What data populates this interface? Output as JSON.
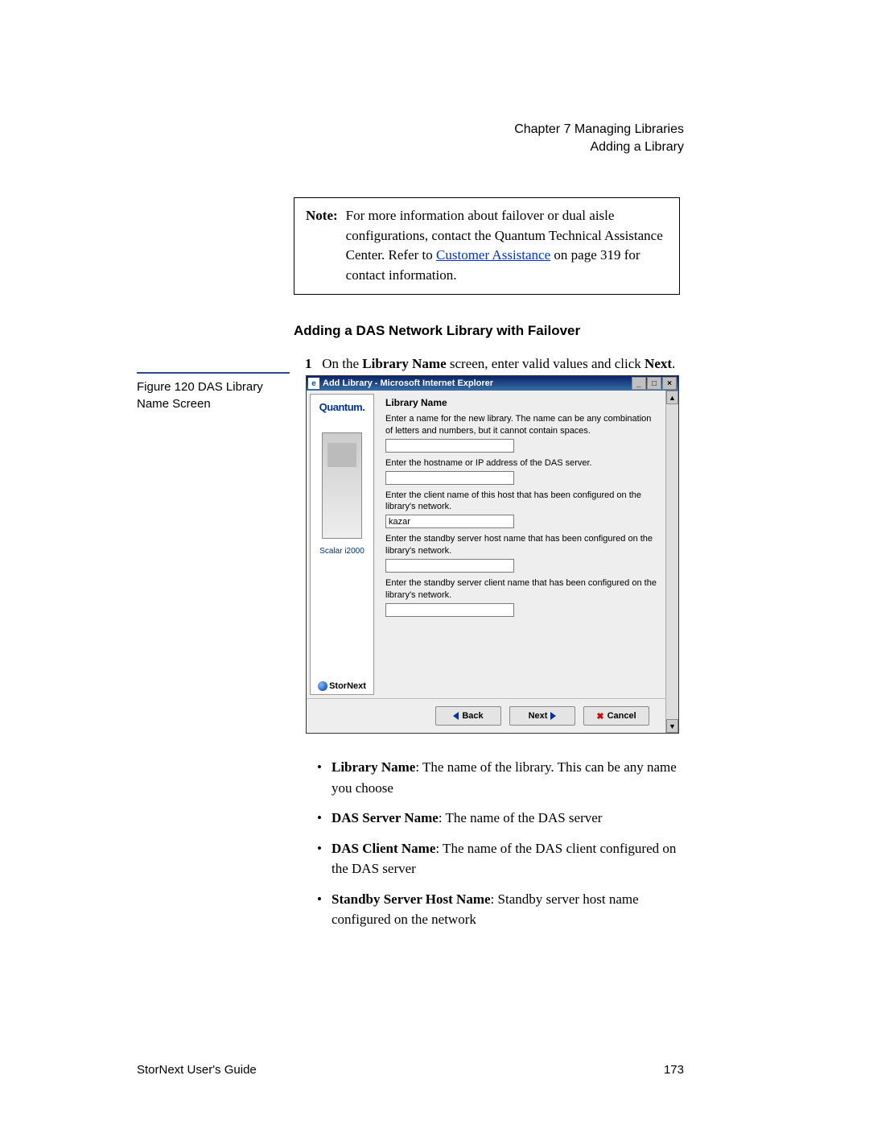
{
  "header": {
    "chapter": "Chapter 7  Managing Libraries",
    "section": "Adding a Library"
  },
  "note": {
    "label": "Note:",
    "text_before_link": "For more information about failover or dual aisle configurations, contact the Quantum Technical Assistance Center. Refer to ",
    "link_text": "Customer Assistance",
    "text_after_link": " on page  319 for contact information."
  },
  "section_heading": "Adding a DAS Network Library with Failover",
  "step1": {
    "num": "1",
    "text_before": "On the ",
    "bold1": "Library Name",
    "text_mid": " screen, enter valid values and click ",
    "bold2": "Next",
    "text_after": "."
  },
  "figure_caption": "Figure 120   DAS Library Name Screen",
  "window": {
    "title": "Add Library - Microsoft Internet Explorer",
    "sidebar": {
      "brand": "Quantum.",
      "model": "Scalar i2000",
      "product": "StorNext"
    },
    "form": {
      "title": "Library Name",
      "desc": "Enter a name for the new library. The name can be any combination of letters and numbers, but it cannot contain spaces.",
      "val1": "",
      "label2": "Enter the hostname or IP address of the DAS server.",
      "val2": "",
      "label3": "Enter the client name of this host that has been configured on the library's network.",
      "val3": "kazar",
      "label4": "Enter the standby server host name that has been configured on the library's network.",
      "val4": "",
      "label5": "Enter the standby server client name that has been configured on the library's network.",
      "val5": ""
    },
    "buttons": {
      "back": "Back",
      "next": "Next",
      "cancel": "Cancel"
    }
  },
  "bullets": [
    {
      "bold": "Library Name",
      "rest": ": The name of the library. This can be any name you choose"
    },
    {
      "bold": "DAS Server Name",
      "rest": ": The name of the DAS server"
    },
    {
      "bold": "DAS Client Name",
      "rest": ": The name of the DAS client configured on the DAS server"
    },
    {
      "bold": "Standby Server Host Name",
      "rest": ": Standby server host name configured on the network"
    }
  ],
  "footer": {
    "left": "StorNext User's Guide",
    "right": "173"
  }
}
